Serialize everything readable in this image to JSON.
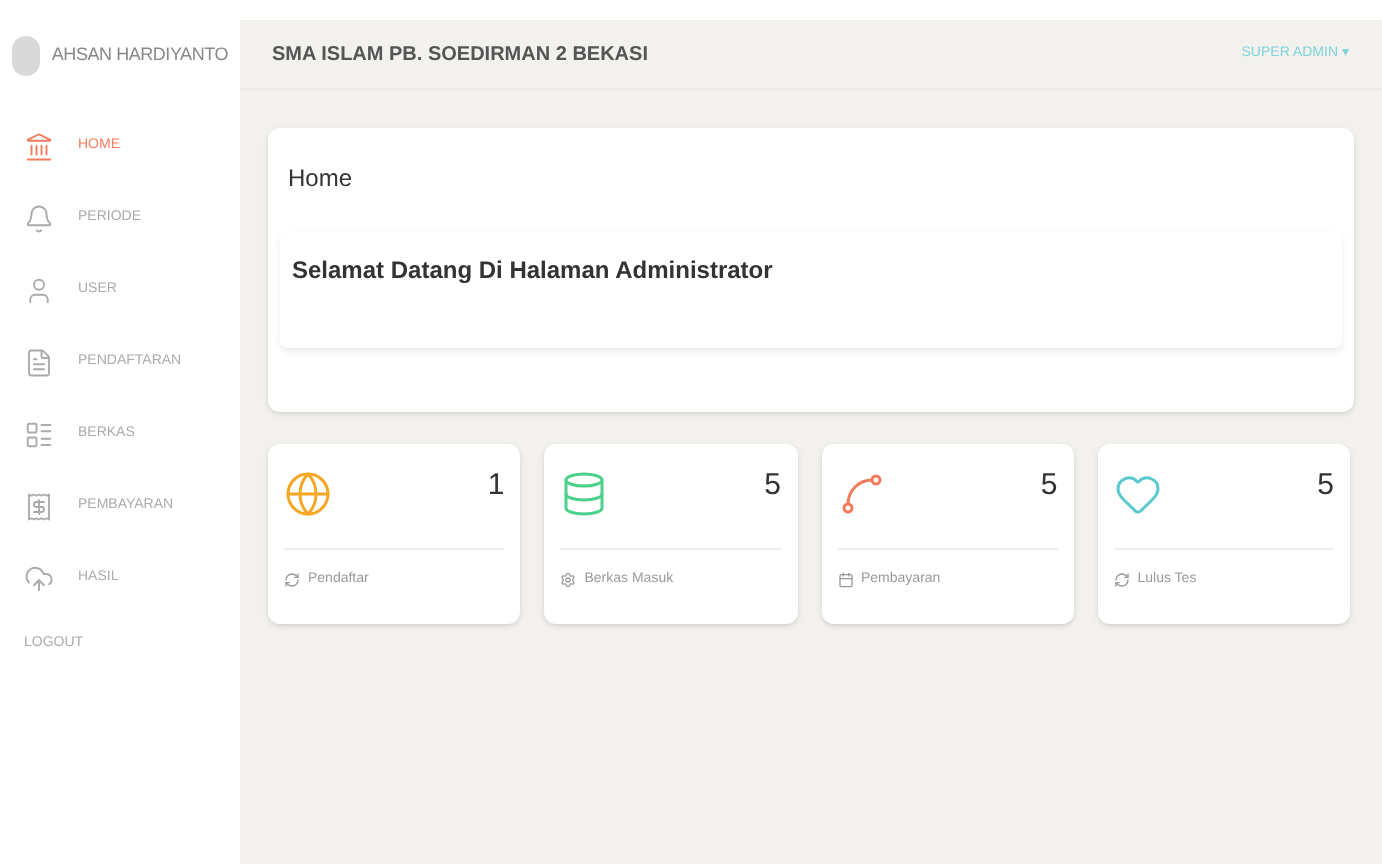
{
  "user": {
    "name": "AHSAN HARDIYANTO"
  },
  "header": {
    "title": "SMA ISLAM PB. SOEDIRMAN 2 BEKASI",
    "account": "SUPER ADMIN",
    "caret": "▾"
  },
  "sidebar": {
    "items": [
      {
        "label": "HOME",
        "selected": true
      },
      {
        "label": "PERIODE",
        "selected": false
      },
      {
        "label": "USER",
        "selected": false
      },
      {
        "label": "PENDAFTARAN",
        "selected": false
      },
      {
        "label": "BERKAS",
        "selected": false
      },
      {
        "label": "PEMBAYARAN",
        "selected": false
      },
      {
        "label": "HASIL",
        "selected": false
      }
    ],
    "logout": "LOGOUT"
  },
  "welcome": {
    "title": "Home",
    "message": "Selamat Datang Di Halaman Administrator"
  },
  "stats": [
    {
      "value": "1",
      "label": "Pendaftar",
      "color": "#f5a623"
    },
    {
      "value": "5",
      "label": "Berkas Masuk",
      "color": "#4cd08b"
    },
    {
      "value": "5",
      "label": "Pembayaran",
      "color": "#f27b5b"
    },
    {
      "value": "5",
      "label": "Lulus Tes",
      "color": "#5bc8d0"
    }
  ]
}
